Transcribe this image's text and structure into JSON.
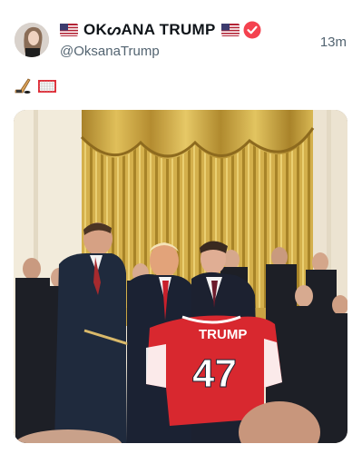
{
  "author": {
    "display_name": "OKᔕANA TRUMP",
    "handle": "@OksanaTrump",
    "verified": true,
    "flag_left": "us-flag-icon",
    "flag_right": "us-flag-icon"
  },
  "post": {
    "timestamp": "13m",
    "emojis": [
      "ice-hockey-icon",
      "goal-net-icon"
    ]
  },
  "media": {
    "jersey_name": "TRUMP",
    "jersey_number": "47"
  },
  "colors": {
    "text": "#0f1419",
    "secondary_text": "#536471",
    "verified_badge": "#f4424f",
    "jersey_red": "#d8282f"
  }
}
